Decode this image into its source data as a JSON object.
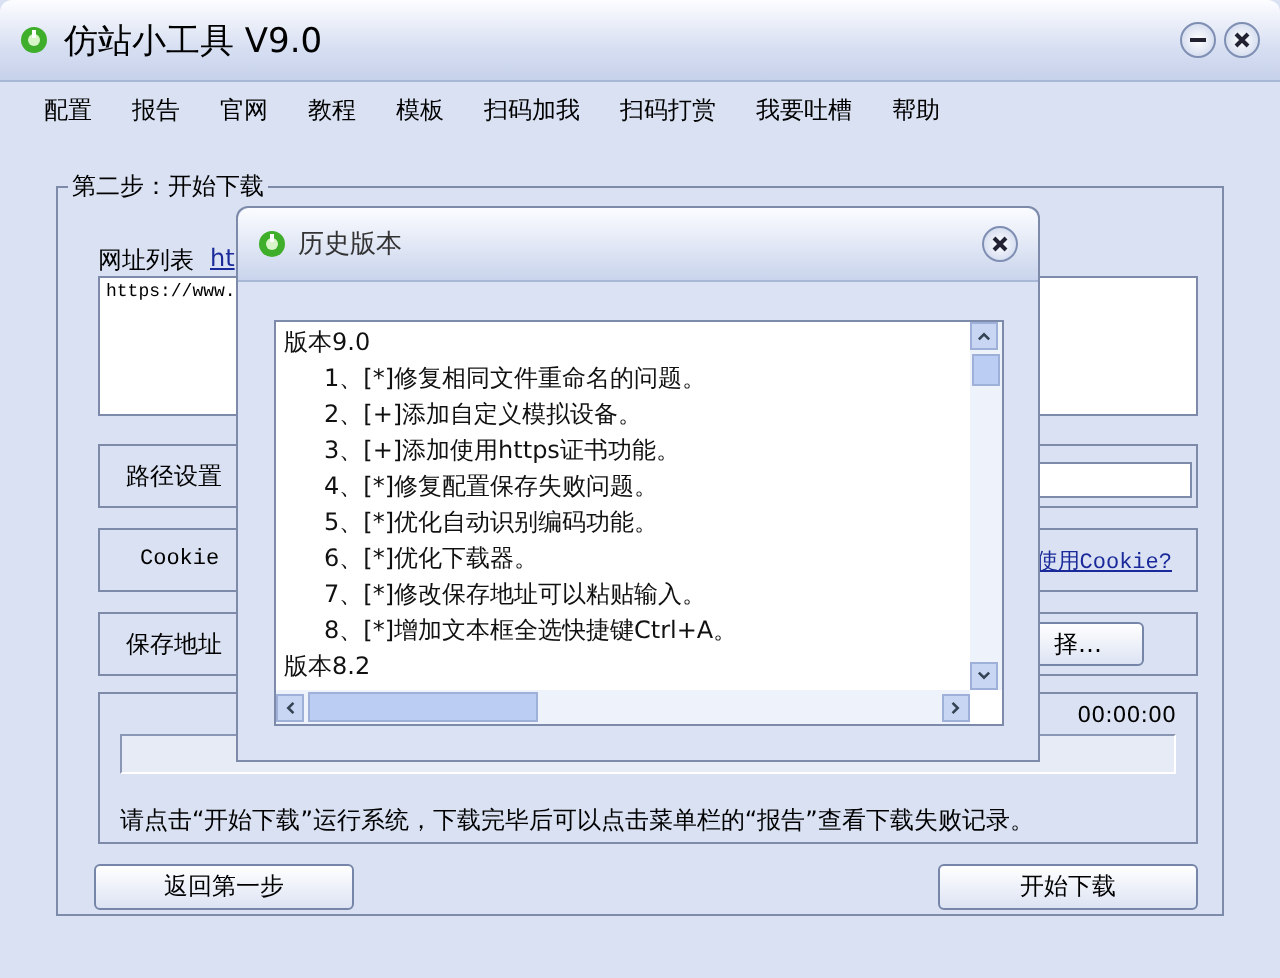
{
  "window": {
    "title": "仿站小工具 V9.0"
  },
  "menu": [
    "配置",
    "报告",
    "官网",
    "教程",
    "模板",
    "扫码加我",
    "扫码打赏",
    "我要吐槽",
    "帮助"
  ],
  "group": {
    "title": "第二步：开始下载"
  },
  "url_list": {
    "label": "网址列表",
    "link": "ht",
    "value": "https://www."
  },
  "path_button": "路径设置",
  "cookie_label": "Cookie",
  "cookie_link": "使用Cookie?",
  "save_button": "保存地址",
  "choose_button": "择…",
  "progress": {
    "time": "00:00:00",
    "level": 0
  },
  "hint": "请点击“开始下载”运行系统，下载完毕后可以点击菜单栏的“报告”查看下载失败记录。",
  "buttons": [
    "返回第一步",
    "开始下载"
  ],
  "dialog": {
    "title": "历史版本",
    "lines": [
      {
        "kind": "heading",
        "text": "版本9.0"
      },
      {
        "kind": "item",
        "text": "1、[*]修复相同文件重命名的问题。"
      },
      {
        "kind": "item",
        "text": "2、[+]添加自定义模拟设备。"
      },
      {
        "kind": "item",
        "text": "3、[+]添加使用https证书功能。"
      },
      {
        "kind": "item",
        "text": "4、[*]修复配置保存失败问题。"
      },
      {
        "kind": "item",
        "text": "5、[*]优化自动识别编码功能。"
      },
      {
        "kind": "item",
        "text": "6、[*]优化下载器。"
      },
      {
        "kind": "item",
        "text": "7、[*]修改保存地址可以粘贴输入。"
      },
      {
        "kind": "item",
        "text": "8、[*]增加文本框全选快捷键Ctrl+A。"
      },
      {
        "kind": "heading",
        "text": "版本8.2"
      }
    ]
  }
}
